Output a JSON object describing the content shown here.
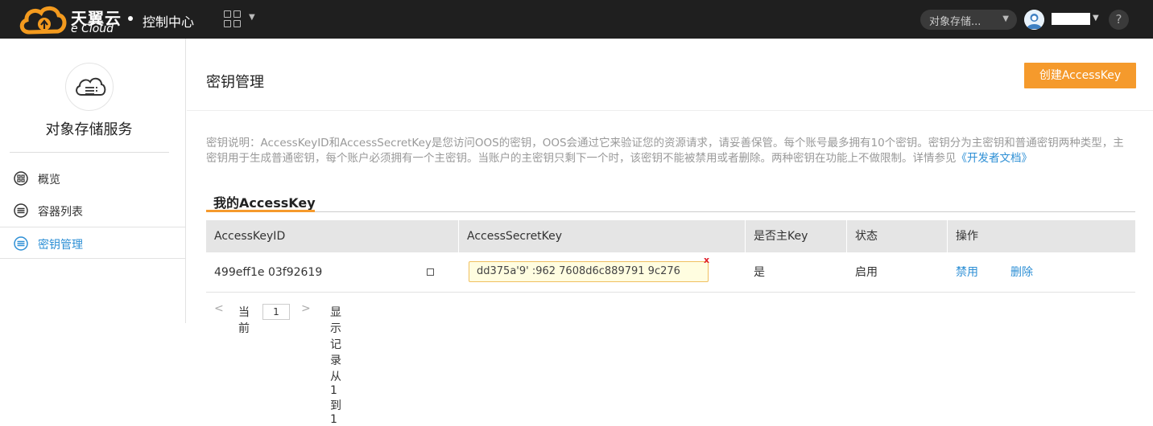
{
  "topbar": {
    "logo_zh": "天翼云",
    "logo_en": "e Cloud",
    "console_label": "控制中心",
    "service_select_value": "对象存储...",
    "help_label": "?"
  },
  "sidebar": {
    "title": "对象存储服务",
    "items": [
      {
        "label": "概览",
        "icon": "dashboard-icon"
      },
      {
        "label": "容器列表",
        "icon": "list-icon"
      },
      {
        "label": "密钥管理",
        "icon": "key-list-icon"
      }
    ],
    "active_index": 2
  },
  "main": {
    "title": "密钥管理",
    "create_button": "创建AccessKey",
    "description": "密钥说明：AccessKeyID和AccessSecretKey是您访问OOS的密钥，OOS会通过它来验证您的资源请求，请妥善保管。每个账号最多拥有10个密钥。密钥分为主密钥和普通密钥两种类型，主密钥用于生成普通密钥，每个账户必须拥有一个主密钥。当账户的主密钥只剩下一个时，该密钥不能被禁用或者删除。两种密钥在功能上不做限制。详情参见",
    "doc_link": "《开发者文档》",
    "section_title": "我的AccessKey",
    "table": {
      "headers": [
        "AccessKeyID",
        "AccessSecretKey",
        "是否主Key",
        "状态",
        "操作"
      ],
      "rows": [
        {
          "access_key_id": "499eff1e    03f92619",
          "secret_key": "dd375a'9' :962     7608d6c889791      9c276",
          "secret_close": "x",
          "is_primary": "是",
          "status": "启用",
          "action_disable": "禁用",
          "action_delete": "删除"
        }
      ]
    },
    "pager": {
      "prev": "<",
      "current_label": "当前",
      "page": "1",
      "next": ">",
      "summary": "显示记录从1到1"
    }
  },
  "colors": {
    "topbar_bg": "#1f1f1f",
    "accent_orange": "#f59a2c",
    "link_blue": "#2d8fd5",
    "logo_orange": "#f39a1e"
  }
}
